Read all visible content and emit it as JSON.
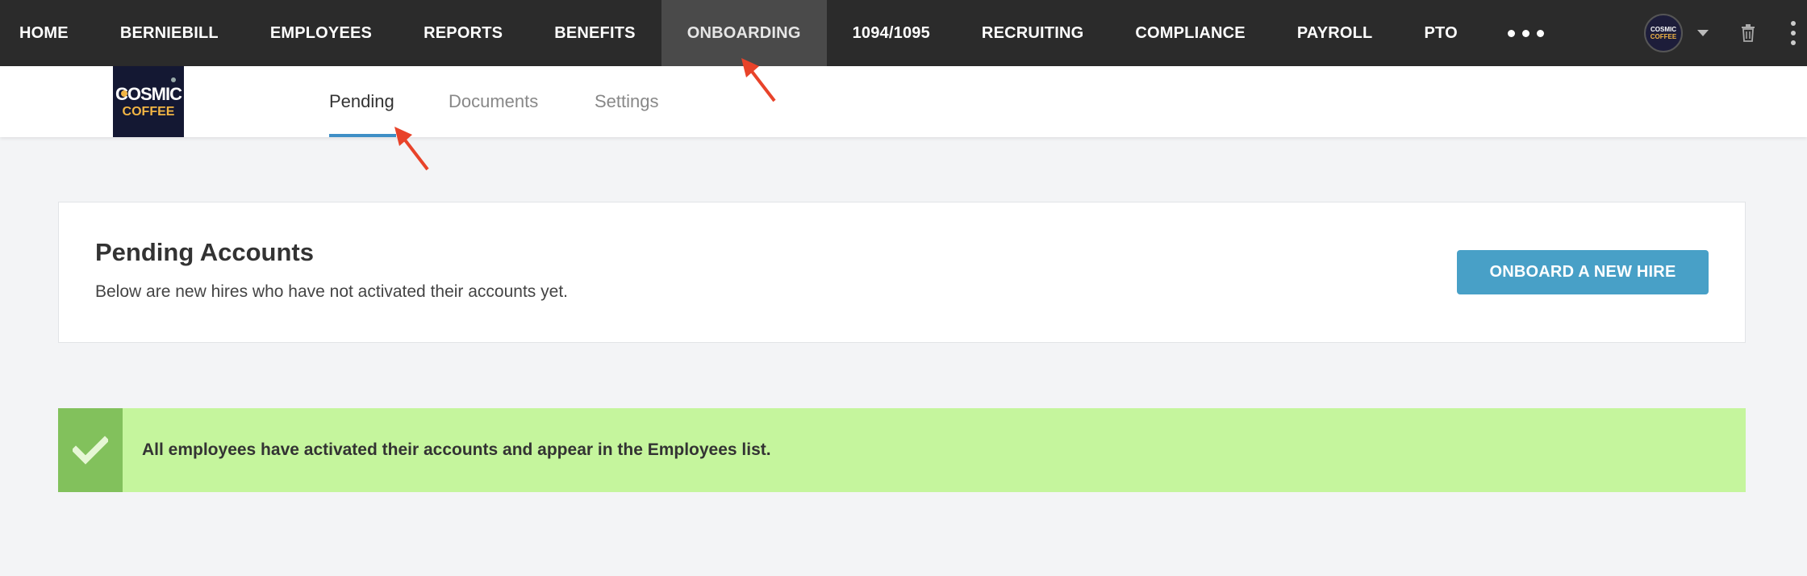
{
  "nav": {
    "items": [
      {
        "label": "HOME",
        "name": "nav-home"
      },
      {
        "label": "BERNIEBILL",
        "name": "nav-berniebill"
      },
      {
        "label": "EMPLOYEES",
        "name": "nav-employees"
      },
      {
        "label": "REPORTS",
        "name": "nav-reports"
      },
      {
        "label": "BENEFITS",
        "name": "nav-benefits"
      },
      {
        "label": "ONBOARDING",
        "name": "nav-onboarding"
      },
      {
        "label": "1094/1095",
        "name": "nav-1094-1095"
      },
      {
        "label": "RECRUITING",
        "name": "nav-recruiting"
      },
      {
        "label": "COMPLIANCE",
        "name": "nav-compliance"
      },
      {
        "label": "PAYROLL",
        "name": "nav-payroll"
      },
      {
        "label": "PTO",
        "name": "nav-pto"
      }
    ],
    "active": "ONBOARDING",
    "avatar_text_1": "COSMIC",
    "avatar_text_2": "COFFEE"
  },
  "logo": {
    "line1": "COSMIC",
    "line2": "COFFEE"
  },
  "tabs": {
    "pending": "Pending",
    "documents": "Documents",
    "settings": "Settings",
    "active": "Pending"
  },
  "card": {
    "title": "Pending Accounts",
    "subtitle": "Below are new hires who have not activated their accounts yet.",
    "button": "ONBOARD A NEW HIRE"
  },
  "alert": {
    "message": "All employees have activated their accounts and appear in the Employees list."
  },
  "colors": {
    "nav_bg": "#2b2b2b",
    "nav_active_bg": "#4a4a4a",
    "accent": "#48a0c7",
    "tab_underline": "#3f8fc6",
    "alert_bg": "#c5f59d",
    "alert_icon_bg": "#82c15c",
    "annotation_arrow": "#e8432a"
  },
  "icons": [
    "more-horizontal-icon",
    "caret-down-icon",
    "trash-icon",
    "more-vertical-icon",
    "check-icon",
    "annotation-arrow-icon"
  ]
}
